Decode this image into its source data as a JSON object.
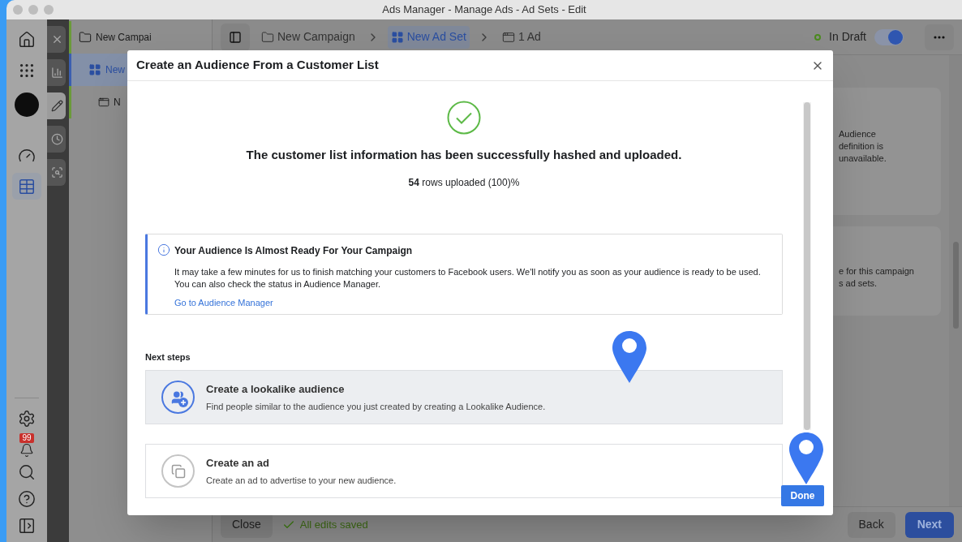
{
  "window": {
    "title": "Ads Manager - Manage Ads - Ad Sets - Edit"
  },
  "rail": {
    "top_items": [
      {
        "kind": "home",
        "selected": false
      },
      {
        "kind": "apps",
        "selected": false
      },
      {
        "kind": "avatar",
        "selected": false
      },
      {
        "kind": "gauge",
        "selected": false
      },
      {
        "kind": "table",
        "selected": true
      }
    ],
    "bottom_items": [
      {
        "kind": "settings",
        "selected": false
      },
      {
        "kind": "bell",
        "selected": false,
        "badge": "99"
      },
      {
        "kind": "search",
        "selected": false
      },
      {
        "kind": "help",
        "selected": false
      },
      {
        "kind": "panel",
        "selected": false
      }
    ]
  },
  "tool_strip": [
    {
      "kind": "close",
      "selected": false
    },
    {
      "kind": "chart",
      "selected": false
    },
    {
      "kind": "edit",
      "selected": true
    },
    {
      "kind": "history",
      "selected": false
    },
    {
      "kind": "inspect",
      "selected": false
    }
  ],
  "tree": [
    {
      "label": "New Campai",
      "kind": "campaign",
      "selected": false,
      "children": [
        {
          "label": "New",
          "kind": "adset",
          "selected": true,
          "children": [
            {
              "label": "N",
              "kind": "ad",
              "selected": false
            }
          ]
        }
      ]
    }
  ],
  "breadcrumbs": [
    {
      "label": "New Campaign",
      "kind": "campaign",
      "selected": false
    },
    {
      "label": "New Ad Set",
      "kind": "adset",
      "selected": true
    },
    {
      "label": "1 Ad",
      "kind": "ad",
      "selected": false
    }
  ],
  "status": {
    "label": "In Draft",
    "on": true
  },
  "side_cards": [
    {
      "lines": [
        "Audience",
        "definition is",
        "unavailable."
      ]
    },
    {
      "lines": [
        "e for this campaign",
        "s ad sets."
      ]
    }
  ],
  "footer": {
    "close": "Close",
    "saved": "All edits saved",
    "back": "Back",
    "next": "Next"
  },
  "dialog": {
    "title": "Create an Audience From a Customer List",
    "heading": "The customer list information has been successfully hashed and uploaded.",
    "rows_uploaded": "**54** rows uploaded (100)%",
    "notice": {
      "title": "Your Audience Is Almost Ready For Your Campaign",
      "body": "It may take a few minutes for us to finish matching your customers to Facebook users. We'll notify you as soon as your audience is ready to be used. You can also check the status in Audience Manager.",
      "link": "Go to Audience Manager"
    },
    "next_steps_title": "Next steps",
    "steps": [
      {
        "kind": "lookalike",
        "title": "Create a lookalike audience",
        "description": "Find people similar to the audience you just created by creating a Lookalike Audience.",
        "selected": true
      },
      {
        "kind": "ad",
        "title": "Create an ad",
        "description": "Create an ad to advertise to your new audience.",
        "selected": false
      }
    ],
    "done": "Done"
  }
}
